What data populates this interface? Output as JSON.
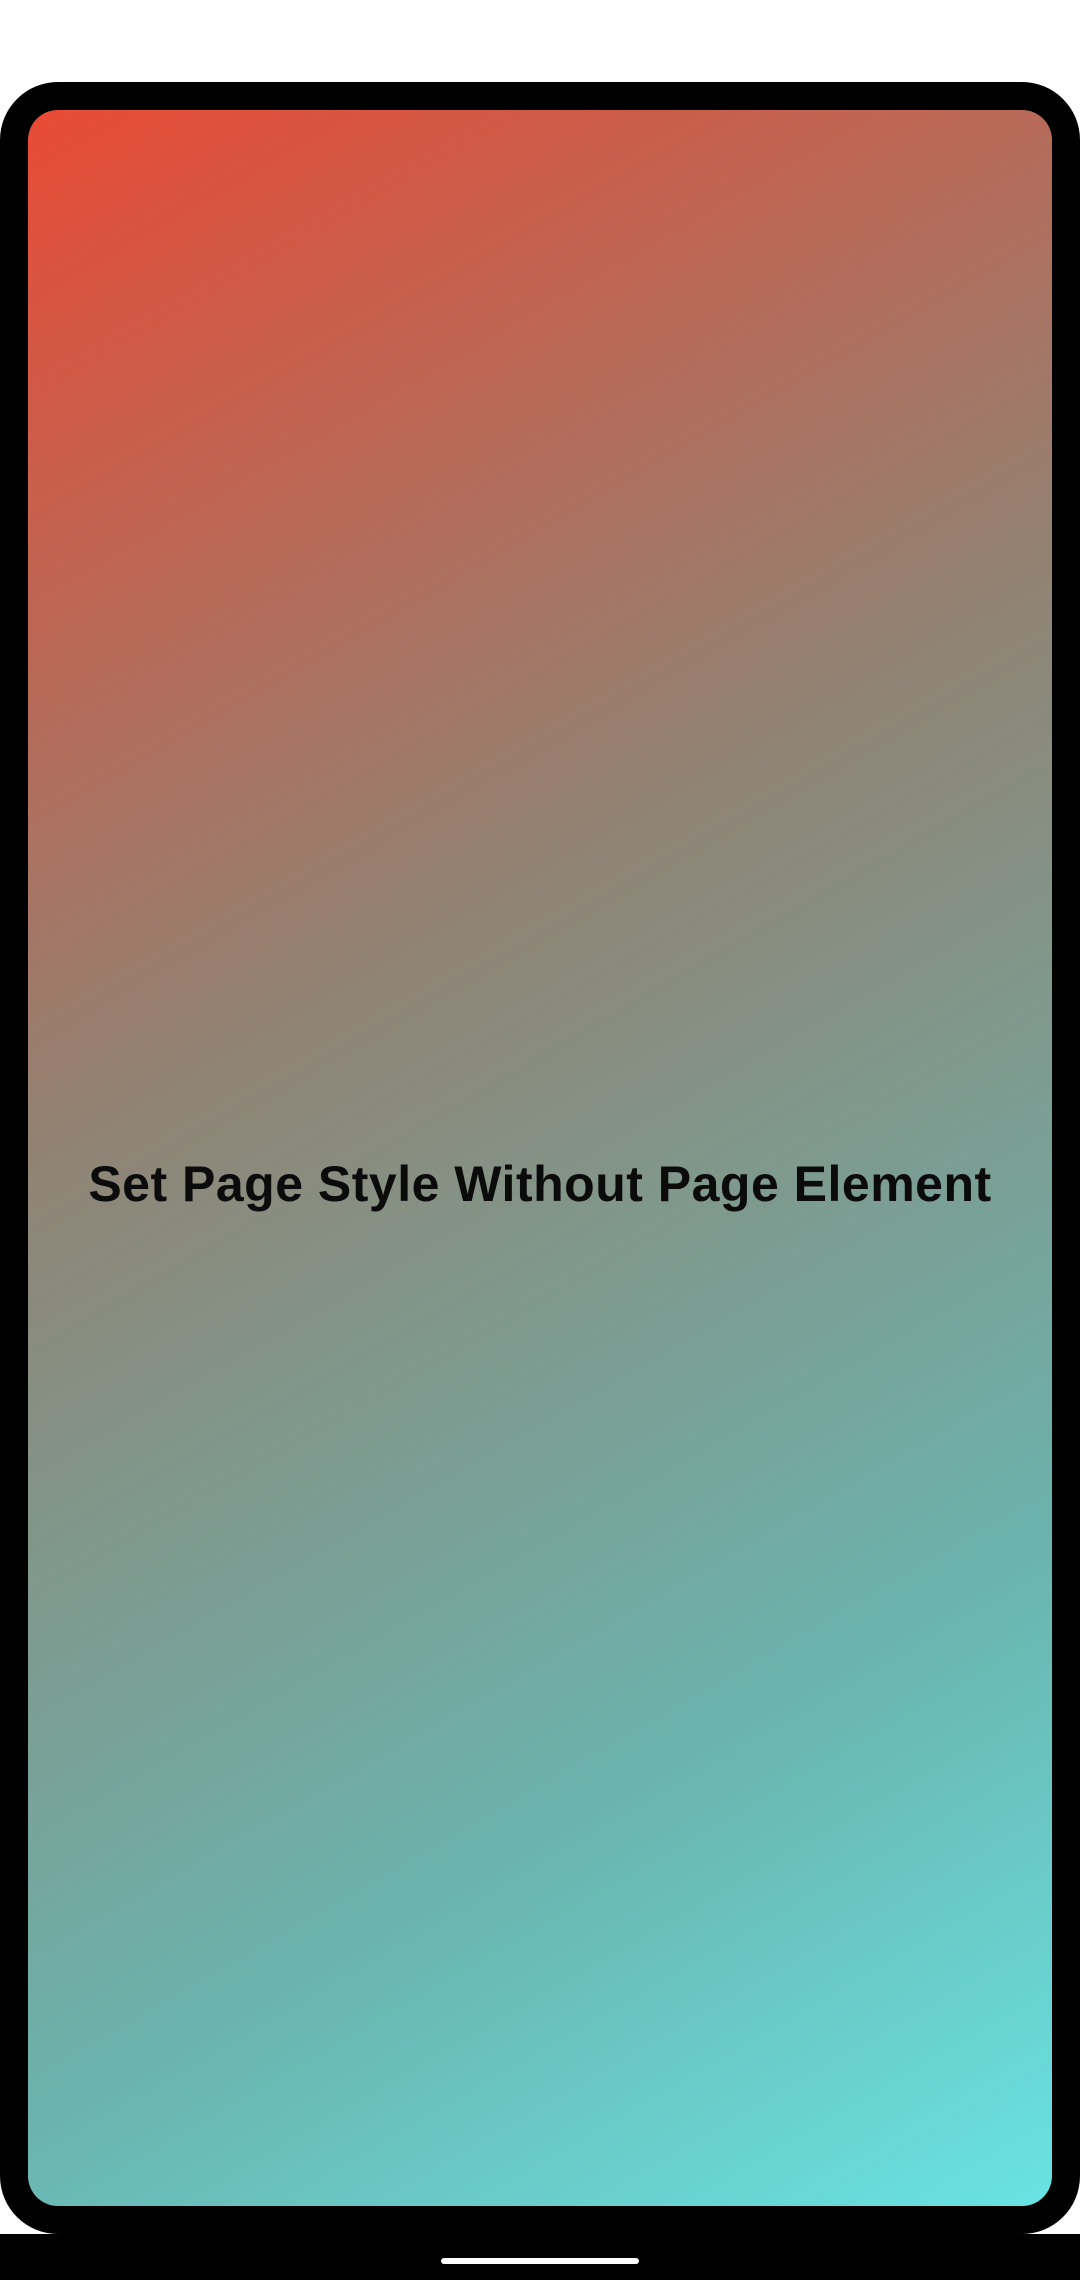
{
  "page": {
    "title": "Set Page Style Without Page Element",
    "gradient": {
      "start_color": "#e84a35",
      "end_color": "#68e3e3"
    }
  },
  "device": {
    "frame_color": "#000000"
  },
  "system": {
    "navigation": "gesture-home-indicator"
  }
}
